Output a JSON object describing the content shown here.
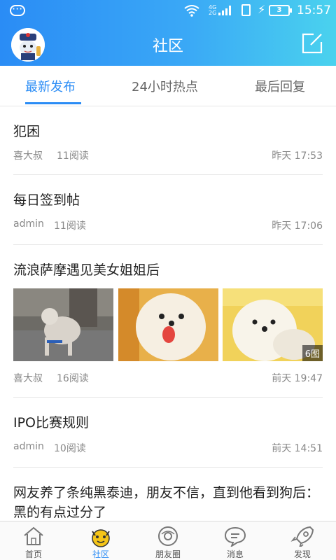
{
  "status_bar": {
    "network_label": "4G\n2G",
    "battery_level": "3",
    "clock": "15:57"
  },
  "header": {
    "title": "社区"
  },
  "tabs": [
    {
      "label": "最新发布",
      "active": true
    },
    {
      "label": "24小时热点",
      "active": false
    },
    {
      "label": "最后回复",
      "active": false
    }
  ],
  "posts": [
    {
      "title": "犯困",
      "author": "喜大叔",
      "reads": "11阅读",
      "time": "昨天 17:53"
    },
    {
      "title": "每日签到帖",
      "author": "admin",
      "reads": "11阅读",
      "time": "昨天 17:06"
    },
    {
      "title": "流浪萨摩遇见美女姐姐后",
      "author": "喜大叔",
      "reads": "16阅读",
      "time": "前天 19:47",
      "image_count": "6图"
    },
    {
      "title": "IPO比赛规则",
      "author": "admin",
      "reads": "10阅读",
      "time": "前天 14:51"
    },
    {
      "title": "网友养了条纯黑泰迪，朋友不信，直到他看到狗后：黑的有点过分了"
    }
  ],
  "bottom_nav": [
    {
      "label": "首页",
      "icon": "home-icon"
    },
    {
      "label": "社区",
      "icon": "community-icon",
      "active": true
    },
    {
      "label": "朋友圈",
      "icon": "moments-icon"
    },
    {
      "label": "消息",
      "icon": "message-icon"
    },
    {
      "label": "发现",
      "icon": "rocket-icon"
    }
  ],
  "colors": {
    "accent": "#2a8cf5",
    "header_gradient_end": "#4ad2ee",
    "nav_active": "#f5c518"
  }
}
